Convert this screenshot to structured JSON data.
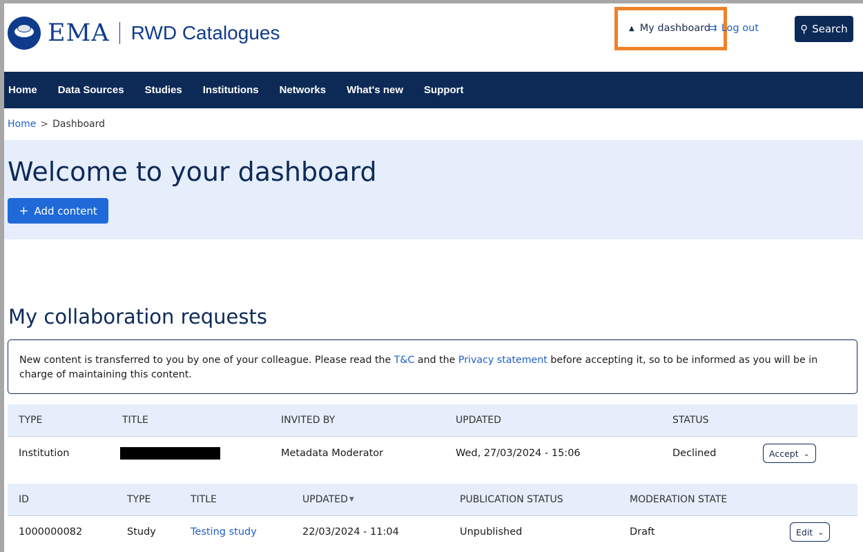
{
  "header": {
    "logo_text": "EMA",
    "site_name": "RWD Catalogues",
    "my_dashboard": "My dashboard",
    "logout": "Log out",
    "search": "Search",
    "icons": {
      "user": "user-icon",
      "logout": "logout-icon",
      "search": "search-icon"
    },
    "highlight_color": "#ef8229"
  },
  "nav": {
    "items": [
      "Home",
      "Data Sources",
      "Studies",
      "Institutions",
      "Networks",
      "What's new",
      "Support"
    ]
  },
  "breadcrumb": {
    "home": "Home",
    "separator": ">",
    "current": "Dashboard"
  },
  "hero": {
    "title": "Welcome to your dashboard",
    "add_button": "Add content",
    "add_icon": "+"
  },
  "collab": {
    "title": "My collaboration requests",
    "notice": {
      "text_1": "New content is transferred to you by one of your colleague. Please read the ",
      "link_1": "T&C",
      "text_2": " and the ",
      "link_2": "Privacy statement",
      "text_3": " before accepting it, so to be informed as you will be in charge of maintaining this content."
    },
    "columns": {
      "type": "TYPE",
      "title": "TITLE",
      "invited_by": "INVITED BY",
      "updated": "UPDATED",
      "status": "STATUS"
    },
    "row": {
      "type": "Institution",
      "title": "",
      "invited_by": "Metadata Moderator",
      "updated": "Wed, 27/03/2024 - 15:06",
      "status": "Declined",
      "action": "Accept"
    }
  },
  "content": {
    "columns": {
      "id": "ID",
      "type": "TYPE",
      "title": "TITLE",
      "updated": "UPDATED",
      "publication_status": "PUBLICATION STATUS",
      "moderation_state": "MODERATION STATE"
    },
    "row": {
      "id": "1000000082",
      "type": "Study",
      "title": "Testing study",
      "updated": "22/03/2024 - 11:04",
      "publication_status": "Unpublished",
      "moderation_state": "Draft",
      "action": "Edit"
    }
  },
  "colors": {
    "navy": "#0d2a57",
    "link": "#1f5fc4",
    "button_blue": "#1f6ad8",
    "light_bg": "#e6eefb"
  }
}
